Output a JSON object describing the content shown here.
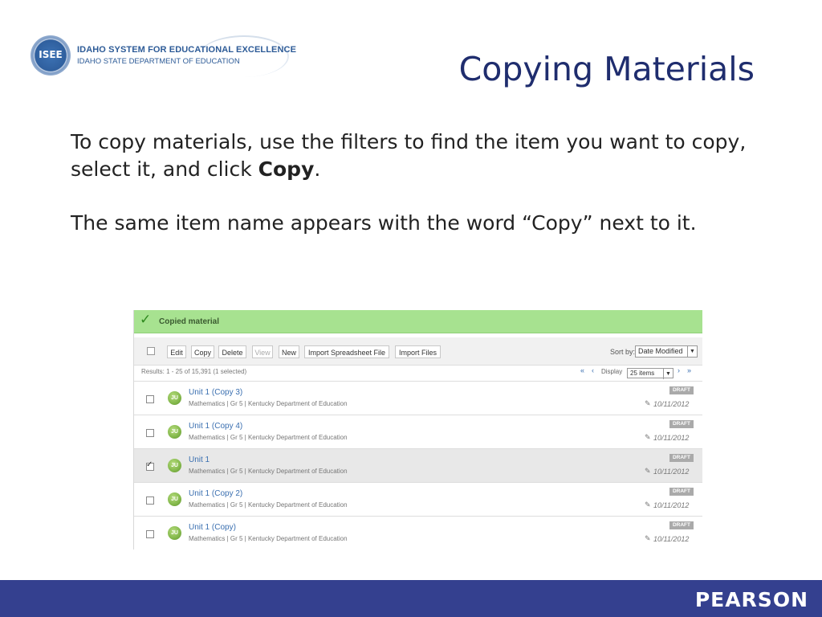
{
  "header": {
    "logo_seal": "ISEE",
    "logo_line1": "IDAHO SYSTEM FOR EDUCATIONAL EXCELLENCE",
    "logo_line2": "IDAHO STATE DEPARTMENT OF EDUCATION",
    "title": "Copying Materials"
  },
  "body": {
    "p1_text": "To copy materials, use the filters to find the item you want to copy, select it, and click ",
    "p1_bold": "Copy",
    "p1_end": ".",
    "p2": "The same item name appears with the word “Copy” next to it."
  },
  "screenshot": {
    "notice": "Copied material",
    "toolbar": {
      "buttons": [
        "Edit",
        "Copy",
        "Delete",
        "View",
        "New",
        "Import Spreadsheet File",
        "Import Files"
      ],
      "sort_label": "Sort by:",
      "sort_value": "Date Modified"
    },
    "pager": {
      "results": "Results: 1 - 25 of 15,391 (1 selected)",
      "display_label": "Display",
      "per_page": "25 items"
    },
    "rows": [
      {
        "title": "Unit 1 (Copy 3)",
        "meta": "Mathematics  |  Gr 5  |  Kentucky Department of Education",
        "status": "DRAFT",
        "date": "10/11/2012",
        "checked": false
      },
      {
        "title": "Unit 1 (Copy 4)",
        "meta": "Mathematics  |  Gr 5  |  Kentucky Department of Education",
        "status": "DRAFT",
        "date": "10/11/2012",
        "checked": false
      },
      {
        "title": "Unit 1",
        "meta": "Mathematics  |  Gr 5  |  Kentucky Department of Education",
        "status": "DRAFT",
        "date": "10/11/2012",
        "checked": true
      },
      {
        "title": "Unit 1 (Copy 2)",
        "meta": "Mathematics  |  Gr 5  |  Kentucky Department of Education",
        "status": "DRAFT",
        "date": "10/11/2012",
        "checked": false
      },
      {
        "title": "Unit 1 (Copy)",
        "meta": "Mathematics  |  Gr 5  |  Kentucky Department of Education",
        "status": "DRAFT",
        "date": "10/11/2012",
        "checked": false
      }
    ],
    "icons": {
      "notice": "checkmark-icon",
      "sort": "dropdown-arrow-icon",
      "pager": [
        "first-page-icon",
        "previous-page-icon",
        "next-page-icon",
        "last-page-icon"
      ],
      "row_unit": "unit-icon",
      "row_edit": "pencil-icon"
    },
    "colors": {
      "notice_bg": "#a7e290",
      "link": "#3a6fb0",
      "selected_row": "#e8e8e8"
    }
  },
  "footer": {
    "brand": "PEARSON",
    "bar_color": "#34408f"
  }
}
